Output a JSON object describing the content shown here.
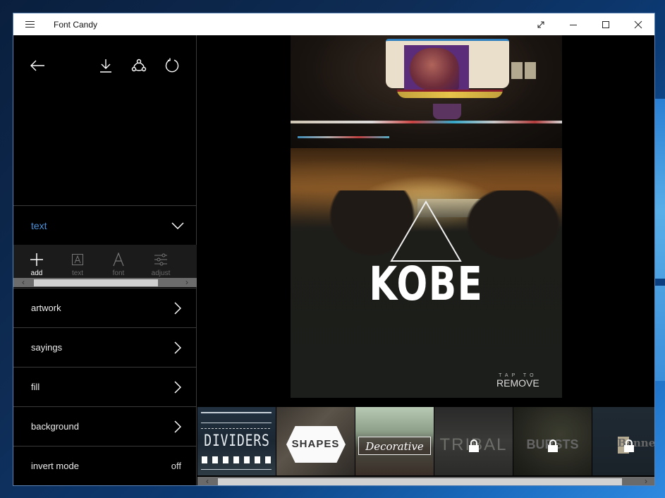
{
  "window": {
    "title": "Font Candy",
    "controls": [
      "fullscreen-icon",
      "minimize-icon",
      "maximize-icon",
      "close-icon"
    ]
  },
  "topbar": {
    "icons": [
      "back-arrow-icon",
      "download-icon",
      "share-icon",
      "refresh-icon"
    ]
  },
  "text_section": {
    "label": "text",
    "expanded": true,
    "tools": [
      {
        "label": "add",
        "icon": "plus-icon",
        "active": true
      },
      {
        "label": "text",
        "icon": "text-box-icon",
        "active": false
      },
      {
        "label": "font",
        "icon": "font-a-icon",
        "active": false
      },
      {
        "label": "adjust",
        "icon": "sliders-icon",
        "active": false
      }
    ]
  },
  "menu": [
    {
      "label": "artwork",
      "icon": "chevron-right-icon"
    },
    {
      "label": "sayings",
      "icon": "chevron-right-icon"
    },
    {
      "label": "fill",
      "icon": "chevron-right-icon"
    },
    {
      "label": "background",
      "icon": "chevron-right-icon"
    },
    {
      "label": "invert mode",
      "value": "off"
    }
  ],
  "canvas": {
    "overlay_text": "KOBE",
    "remove_hint_line1": "TAP TO",
    "remove_hint_line2": "REMOVE"
  },
  "gallery": {
    "items": [
      {
        "label": "DIVIDERS",
        "locked": false
      },
      {
        "label": "SHAPES",
        "locked": false
      },
      {
        "label": "Decorative",
        "locked": false
      },
      {
        "label": "TRIBAL",
        "locked": true
      },
      {
        "label": "BURSTS",
        "locked": true
      },
      {
        "label": "Banners",
        "locked": true
      }
    ]
  },
  "colors": {
    "accent": "#4a8fd9",
    "panel_bg": "#000000",
    "toolrow_bg": "#1b1b1b"
  }
}
